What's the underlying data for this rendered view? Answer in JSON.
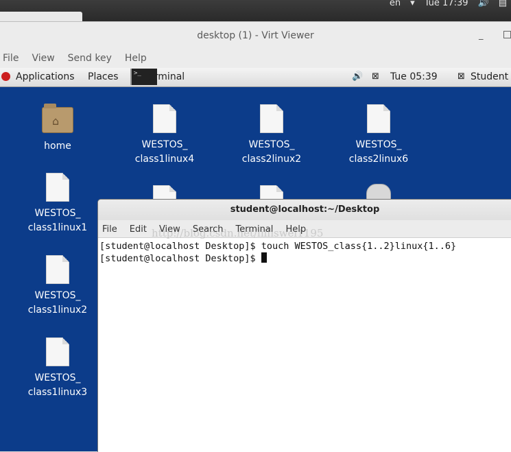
{
  "host_bar": {
    "lang": "en",
    "clock": "Tue 17:39"
  },
  "viewer": {
    "title": "desktop (1) - Virt Viewer",
    "minimize": "_",
    "menu": [
      "File",
      "View",
      "Send key",
      "Help"
    ]
  },
  "guest_panel": {
    "applications": "Applications",
    "places": "Places",
    "terminal": "Terminal",
    "clock": "Tue 05:39",
    "user": "Student"
  },
  "desktop_icons": [
    {
      "label1": "home",
      "label2": "",
      "kind": "folder"
    },
    {
      "label1": "WESTOS_",
      "label2": "class1linux4",
      "kind": "document"
    },
    {
      "label1": "WESTOS_",
      "label2": "class2linux2",
      "kind": "document"
    },
    {
      "label1": "WESTOS_",
      "label2": "class2linux6",
      "kind": "document"
    },
    {
      "label1": "WESTOS_",
      "label2": "class1linux1",
      "kind": "document"
    },
    {
      "label1": "WESTOS_",
      "label2": "class1linux2",
      "kind": "document"
    },
    {
      "label1": "WESTOS_",
      "label2": "class1linux3",
      "kind": "document"
    }
  ],
  "terminal": {
    "title": "student@localhost:~/Desktop",
    "menu": [
      "File",
      "Edit",
      "View",
      "Search",
      "Terminal",
      "Help"
    ],
    "lines": [
      "[student@localhost Desktop]$ touch WESTOS_class{1..2}linux{1..6}",
      "[student@localhost Desktop]$ "
    ],
    "watermark": "http://blog.csdn.net/lilliswel1195"
  },
  "colors": {
    "desktop_bg": "#0c3c8a",
    "apps_icon": "#cc1e1e"
  }
}
